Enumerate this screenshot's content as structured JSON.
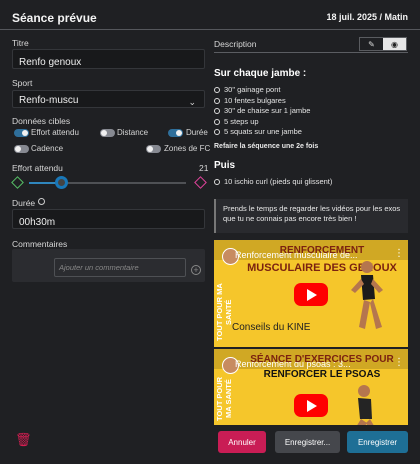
{
  "header": {
    "title": "Séance prévue",
    "date": "18 juil. 2025 / Matin"
  },
  "form": {
    "title_label": "Titre",
    "title_value": "Renfo genoux",
    "sport_label": "Sport",
    "sport_value": "Renfo-muscu",
    "targets_label": "Données cibles",
    "targets": [
      {
        "label": "Effort attendu",
        "on": true
      },
      {
        "label": "Distance",
        "on": false
      },
      {
        "label": "Durée",
        "on": true
      },
      {
        "label": "Cadence",
        "on": false
      },
      {
        "label": "Zones de FC",
        "on": false
      }
    ],
    "effort_label": "Effort attendu",
    "effort_value": "21",
    "effort_level": 0.21,
    "duration_label": "Durée",
    "duration_value": "00h30m",
    "comments_label": "Commentaires",
    "comment_placeholder": "Ajouter un commentaire"
  },
  "description": {
    "label": "Description",
    "heading_1": "Sur chaque jambe :",
    "items_1": [
      "30\" gainage pont",
      "10 fentes bulgares",
      "30\" de chaise sur 1 jambe",
      "5 steps up",
      "5 squats sur une jambe"
    ],
    "repeat": "Refaire la séquence une 2e fois",
    "heading_2": "Puis",
    "items_2": [
      "10 ischio curl (pieds qui glissent)"
    ],
    "note": "Prends le temps de regarder les vidéos pour les exos que tu ne connais pas encore très bien !"
  },
  "videos": [
    {
      "title": "Renforcement musculaire de...",
      "side_text": "TOUT POUR MA SANTÉ",
      "overlay_top": "RENFORCEMENT",
      "overlay_main": "MUSCULAIRE DES GENOUX",
      "subtitle": "Conseils du KINE"
    },
    {
      "title": "Renforcement du psoas : 3...",
      "side_text": "TOUT POUR MA SANTÉ",
      "overlay_top": "SÉANCE D'EXERCICES POUR",
      "overlay_main": "RENFORCER LE PSOAS",
      "subtitle": ""
    }
  ],
  "buttons": {
    "cancel": "Annuler",
    "save_more": "Enregistrer...",
    "save": "Enregistrer"
  },
  "icons": {
    "edit": "pencil-icon",
    "preview": "eye-icon",
    "info": "info-icon",
    "add_comment": "add-comment-icon",
    "delete": "trash-icon"
  },
  "colors": {
    "background": "#1f2023",
    "accent_blue": "#2f6f9b",
    "cancel_red": "#c91d55",
    "save_blue": "#1e6f96"
  }
}
